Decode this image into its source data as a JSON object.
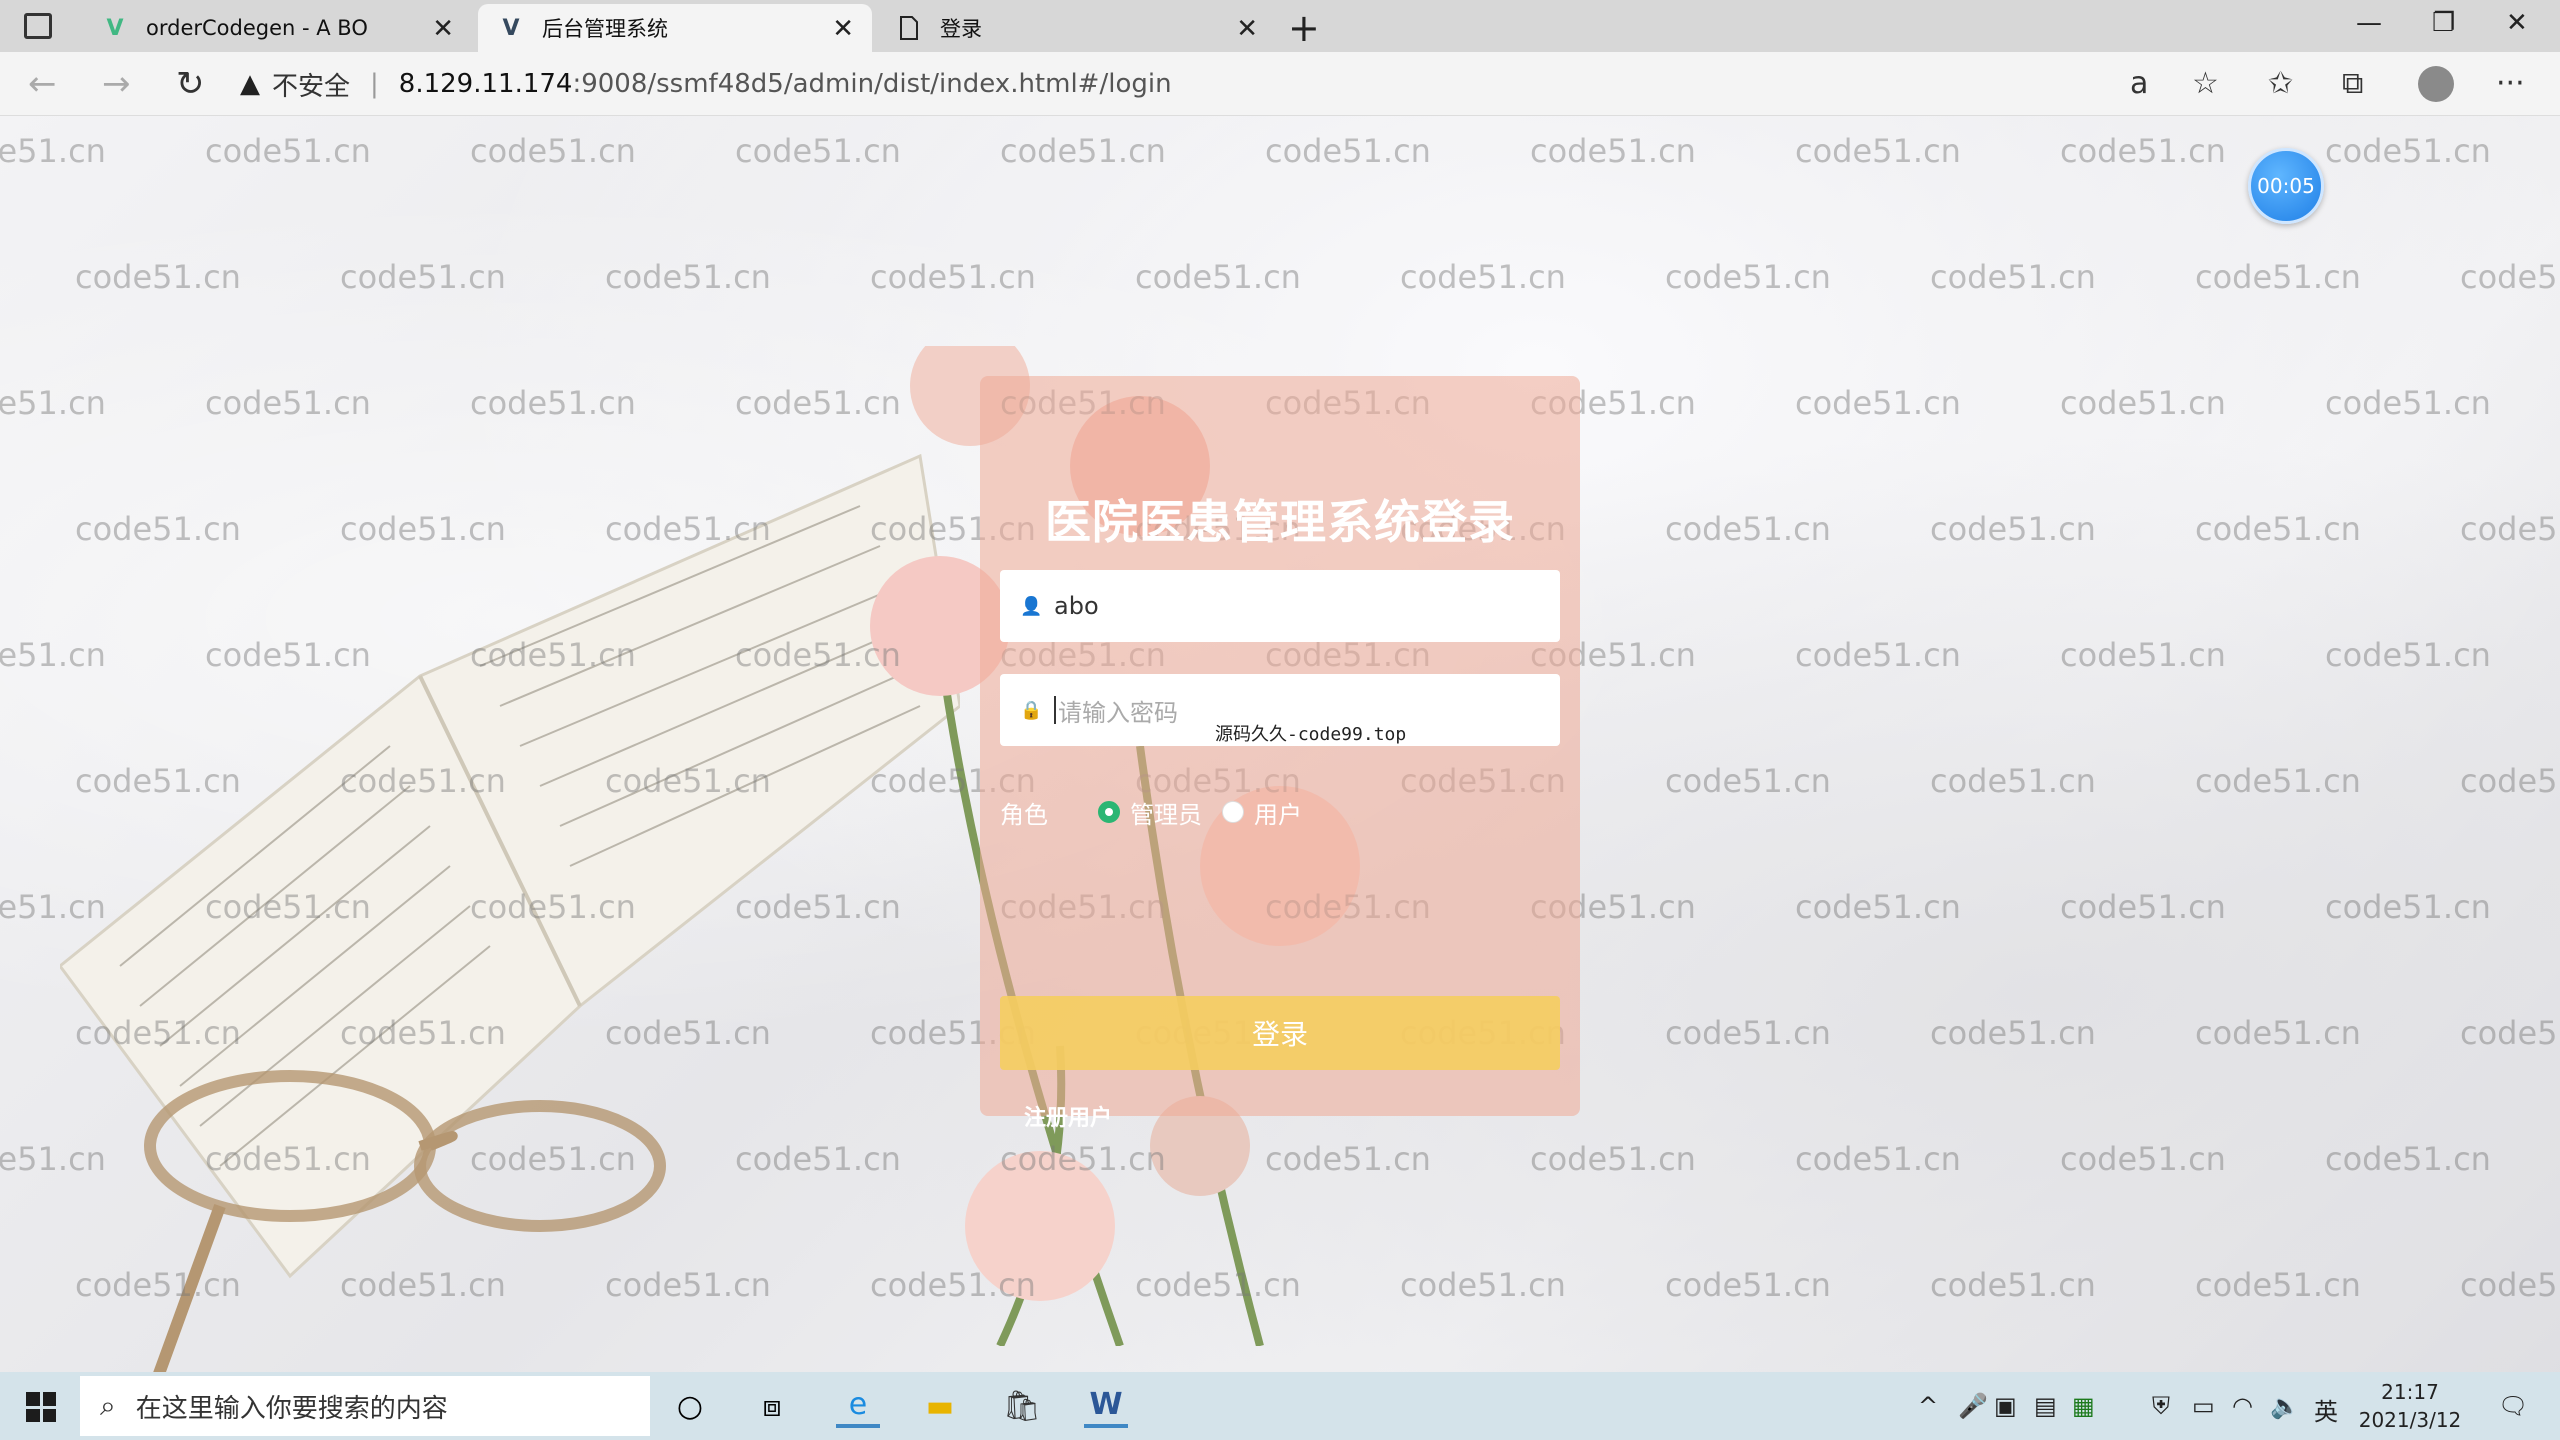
{
  "browser": {
    "tabs": [
      {
        "title": "orderCodegen - A BO",
        "active": false
      },
      {
        "title": "后台管理系统",
        "active": true
      },
      {
        "title": "登录",
        "active": false
      }
    ],
    "security_label": "不安全",
    "url_host": "8.129.11.174",
    "url_path": ":9008/ssmf48d5/admin/dist/index.html#/login"
  },
  "page": {
    "timer": "00:05",
    "title": "医院医患管理系统登录",
    "username_value": "abo",
    "password_placeholder": "请输入密码",
    "overlay_text": "源码久久-code99.top",
    "role_label": "角色",
    "roles": [
      {
        "label": "管理员",
        "checked": true
      },
      {
        "label": "用户",
        "checked": false
      }
    ],
    "login_label": "登录",
    "register_label": "注册用户",
    "watermark": "code51.cn"
  },
  "taskbar": {
    "search_placeholder": "在这里输入你要搜索的内容",
    "ime": "英",
    "time": "21:17",
    "date": "2021/3/12"
  }
}
